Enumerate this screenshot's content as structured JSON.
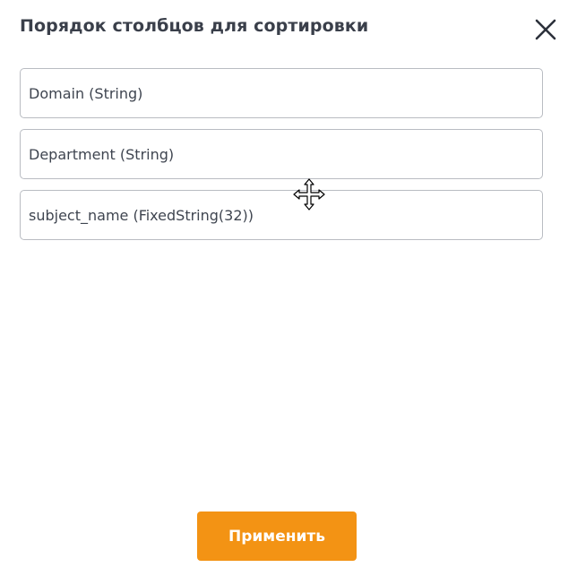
{
  "dialog": {
    "title": "Порядок столбцов для сортировки",
    "close_icon": "close-icon"
  },
  "columns": [
    {
      "label": "Domain (String)"
    },
    {
      "label": "Department (String)"
    },
    {
      "label": "subject_name (FixedString(32))"
    }
  ],
  "cursor": {
    "icon": "move-cursor-icon"
  },
  "footer": {
    "apply_label": "Применить"
  },
  "colors": {
    "accent": "#f39314",
    "title": "#3a3f4a",
    "item_border": "#b9bcc2",
    "item_text": "#3f4550"
  }
}
